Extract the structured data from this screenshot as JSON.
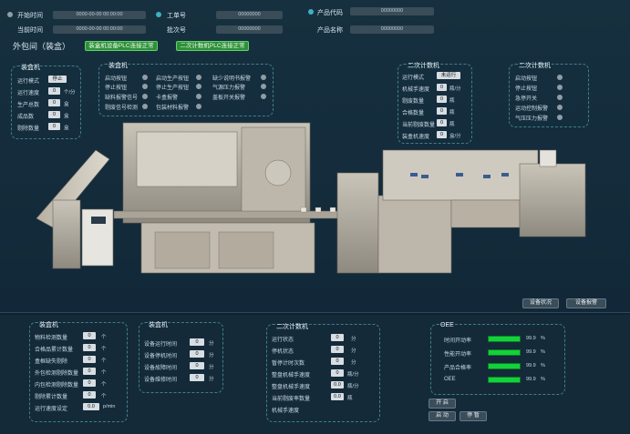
{
  "header": {
    "start_time_label": "开始时间",
    "start_time_value": "0000-00-00 00:00:00",
    "current_time_label": "当前时间",
    "current_time_value": "0000-00-00 00:00:00",
    "work_order_label": "工单号",
    "work_order_value": "00000000",
    "batch_label": "批次号",
    "batch_value": "00000000",
    "product_code_label": "产品代码",
    "product_code_value": "00000000",
    "product_name_label": "产品名称",
    "product_name_value": "00000000",
    "page_title": "外包间（装盒）",
    "status_boxer_plc": "装盒机设备PLC连接正常",
    "status_scale_plc": "二次计数机PLC连接正常"
  },
  "boxer_left": {
    "title": "装盒机",
    "rows": [
      {
        "label": "运行模式",
        "value": "停止",
        "unit": ""
      },
      {
        "label": "运行速度",
        "value": "0",
        "unit": "个/分"
      },
      {
        "label": "生产总数",
        "value": "0",
        "unit": "盒"
      },
      {
        "label": "成品数",
        "value": "0",
        "unit": "盒"
      },
      {
        "label": "剔除数量",
        "value": "0",
        "unit": "盒"
      }
    ]
  },
  "boxer_status": {
    "title": "装盒机",
    "col1": [
      "启动按钮",
      "停止按钮",
      "缺料报警信号",
      "剔废信号检测"
    ],
    "col2": [
      "启动生产按钮",
      "停止生产按钮",
      "卡盒报警",
      "包装材料报警"
    ],
    "col3": [
      "缺少说明书报警",
      "气源压力报警",
      "盖板开关报警"
    ]
  },
  "counter_right": {
    "title": "二次计数机",
    "rows": [
      {
        "label": "运行模式",
        "value": "未运行",
        "unit": ""
      },
      {
        "label": "机械手速度",
        "value": "0",
        "unit": "瓶/分"
      },
      {
        "label": "剔废数量",
        "value": "0",
        "unit": "瓶"
      },
      {
        "label": "合格数量",
        "value": "0",
        "unit": "瓶"
      },
      {
        "label": "当前剔废数量",
        "value": "0",
        "unit": "瓶"
      },
      {
        "label": "装盒机速度",
        "value": "0",
        "unit": "盒/分"
      }
    ]
  },
  "counter_status": {
    "title": "二次计数机",
    "items": [
      "启动按钮",
      "停止按钮",
      "急停开关",
      "运动控制报警",
      "气压压力报警"
    ]
  },
  "side_buttons": {
    "left": "设备状况",
    "right": "设备报警"
  },
  "bottom_boxer": {
    "title": "装盒机",
    "rows": [
      {
        "label": "物料检测数量",
        "value": "0",
        "unit": "个"
      },
      {
        "label": "合格品累计数量",
        "value": "0",
        "unit": "个"
      },
      {
        "label": "盒框缺失剔除",
        "value": "0",
        "unit": "个"
      },
      {
        "label": "外包检测剔除数量",
        "value": "0",
        "unit": "个"
      },
      {
        "label": "内包检测剔除数量",
        "value": "0",
        "unit": "个"
      },
      {
        "label": "剔除累计数量",
        "value": "0",
        "unit": "个"
      },
      {
        "label": "运行速度设定",
        "value": "0.0",
        "unit": "p/min"
      }
    ]
  },
  "bottom_boxer_time": {
    "title": "装盒机",
    "rows": [
      {
        "label": "设备运行时间",
        "value": "0",
        "unit": "分"
      },
      {
        "label": "设备停机时间",
        "value": "0",
        "unit": "分"
      },
      {
        "label": "设备故障时间",
        "value": "0",
        "unit": "分"
      },
      {
        "label": "设备维修时间",
        "value": "0",
        "unit": "分"
      }
    ]
  },
  "bottom_counter": {
    "title": "二次计数机",
    "rows": [
      {
        "label": "运行状态",
        "value": "0",
        "unit": "分"
      },
      {
        "label": "停机状态",
        "value": "0",
        "unit": "分"
      },
      {
        "label": "暂停计时次数",
        "value": "0",
        "unit": "分"
      },
      {
        "label": "整盘机械手速度",
        "value": "0",
        "unit": "瓶/分"
      },
      {
        "label": "整盘机械手速度",
        "value": "0.0",
        "unit": "瓶/分"
      },
      {
        "label": "当前剔废率数量",
        "value": "0.0",
        "unit": "瓶"
      },
      {
        "label": "机械手速度",
        "value": "",
        "unit": ""
      }
    ]
  },
  "oee": {
    "title": "OEE",
    "rows": [
      {
        "label": "时间开动率",
        "value": "99.9",
        "unit": "%",
        "fill": 0.999
      },
      {
        "label": "性能开动率",
        "value": "99.9",
        "unit": "%",
        "fill": 0.999
      },
      {
        "label": "产品合格率",
        "value": "99.9",
        "unit": "%",
        "fill": 0.999
      },
      {
        "label": "OEE",
        "value": "99.9",
        "unit": "%",
        "fill": 0.999
      }
    ],
    "buttons": {
      "open": "开 启",
      "start": "启 动",
      "stop": "停 暂"
    },
    "colors": {
      "bar": "#13d13b"
    }
  }
}
